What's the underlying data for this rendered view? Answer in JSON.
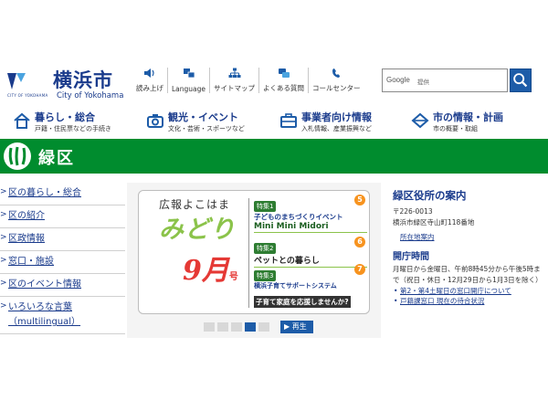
{
  "header": {
    "logo_sub": "CITY OF YOKOHAMA",
    "logo_title": "横浜市",
    "logo_en": "City of Yokohama",
    "tools": [
      {
        "label": "読み上げ",
        "icon": "speaker-icon"
      },
      {
        "label": "Language",
        "icon": "language-icon"
      },
      {
        "label": "サイトマップ",
        "icon": "sitemap-icon"
      },
      {
        "label": "よくある質問",
        "icon": "faq-icon"
      },
      {
        "label": "コールセンター",
        "icon": "callcenter-icon"
      }
    ],
    "search": {
      "brand": "Google",
      "suffix": "提供",
      "button_icon": "search-icon"
    }
  },
  "gnav": [
    {
      "title": "暮らし・総合",
      "sub": "戸籍・住民票などの手続き",
      "icon": "house-icon"
    },
    {
      "title": "観光・イベント",
      "sub": "文化・芸術・スポーツなど",
      "icon": "camera-icon"
    },
    {
      "title": "事業者向け情報",
      "sub": "入札情報、産業振興など",
      "icon": "briefcase-icon"
    },
    {
      "title": "市の情報・計画",
      "sub": "市の概要・取組",
      "icon": "city-icon"
    }
  ],
  "band": {
    "title": "緑区",
    "logo_icon": "midori-ward-emblem-icon",
    "color": "#008c2e"
  },
  "left_menu": [
    {
      "label": "区の暮らし・総合"
    },
    {
      "label": "区の紹介"
    },
    {
      "label": "区政情報"
    },
    {
      "label": "窓口・施設"
    },
    {
      "label": "区のイベント情報"
    },
    {
      "label": "いろいろな言葉（multilingual）"
    }
  ],
  "slide": {
    "kouhou": "広報よこはま",
    "midori": "みどり",
    "month_num": "9月",
    "month_suffix": "号",
    "features": [
      {
        "tag": "特集1",
        "num": "5",
        "line_a": "子どものまちづくりイベント",
        "line_b": "Mini Mini Midori"
      },
      {
        "tag": "特集2",
        "num": "6",
        "line_a": "ペットとの暮らし",
        "line_b": ""
      },
      {
        "tag": "特集3",
        "num": "7",
        "line_a": "横浜子育てサポートシステム",
        "line_b": "子育て家庭を応援しませんか?"
      }
    ]
  },
  "carousel": {
    "slide_count": 5,
    "active_index": 3,
    "play_label": "▶ 再生"
  },
  "info": {
    "title": "緑区役所の案内",
    "postal": "〒226-0013",
    "address": "横浜市緑区寺山町118番地",
    "map_link": "所在地案内",
    "hours_title": "開庁時間",
    "hours_text": "月曜日から金曜日、午前8時45分から午後5時まで（祝日・休日・12月29日から1月3日を除く）",
    "links": [
      "第2・第4土曜日の窓口開庁について",
      "戸籍課窓口 現在の待合状況"
    ]
  },
  "colors": {
    "brand_blue": "#1a3b8c",
    "accent_blue": "#1d5ca8",
    "green": "#008c2e"
  }
}
